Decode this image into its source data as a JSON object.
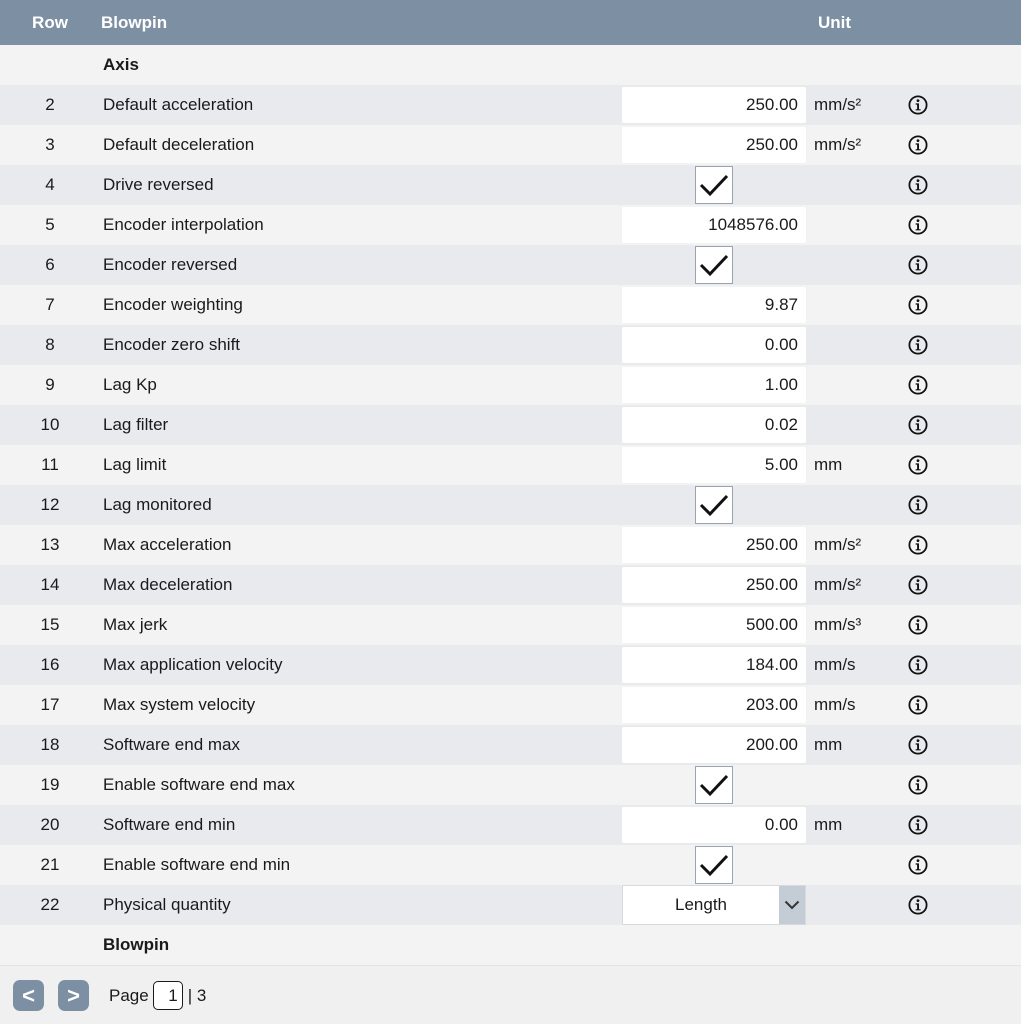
{
  "header": {
    "row_label": "Row",
    "name_label": "Blowpin",
    "unit_label": "Unit"
  },
  "sections": {
    "axis": "Axis",
    "blowpin": "Blowpin"
  },
  "rows": [
    {
      "row": "2",
      "name": "Default acceleration",
      "type": "value",
      "value": "250.00",
      "unit": "mm/s²"
    },
    {
      "row": "3",
      "name": "Default deceleration",
      "type": "value",
      "value": "250.00",
      "unit": "mm/s²"
    },
    {
      "row": "4",
      "name": "Drive reversed",
      "type": "check",
      "checked": true,
      "unit": ""
    },
    {
      "row": "5",
      "name": "Encoder interpolation",
      "type": "value",
      "value": "1048576.00",
      "unit": ""
    },
    {
      "row": "6",
      "name": "Encoder reversed",
      "type": "check",
      "checked": true,
      "unit": ""
    },
    {
      "row": "7",
      "name": "Encoder weighting",
      "type": "value",
      "value": "9.87",
      "unit": ""
    },
    {
      "row": "8",
      "name": "Encoder zero shift",
      "type": "value",
      "value": "0.00",
      "unit": ""
    },
    {
      "row": "9",
      "name": "Lag Kp",
      "type": "value",
      "value": "1.00",
      "unit": ""
    },
    {
      "row": "10",
      "name": "Lag filter",
      "type": "value",
      "value": "0.02",
      "unit": ""
    },
    {
      "row": "11",
      "name": "Lag limit",
      "type": "value",
      "value": "5.00",
      "unit": "mm"
    },
    {
      "row": "12",
      "name": "Lag monitored",
      "type": "check",
      "checked": true,
      "unit": ""
    },
    {
      "row": "13",
      "name": "Max acceleration",
      "type": "value",
      "value": "250.00",
      "unit": "mm/s²"
    },
    {
      "row": "14",
      "name": "Max deceleration",
      "type": "value",
      "value": "250.00",
      "unit": "mm/s²"
    },
    {
      "row": "15",
      "name": "Max jerk",
      "type": "value",
      "value": "500.00",
      "unit": "mm/s³"
    },
    {
      "row": "16",
      "name": "Max application velocity",
      "type": "value",
      "value": "184.00",
      "unit": "mm/s"
    },
    {
      "row": "17",
      "name": "Max system velocity",
      "type": "value",
      "value": "203.00",
      "unit": "mm/s"
    },
    {
      "row": "18",
      "name": "Software end max",
      "type": "value",
      "value": "200.00",
      "unit": "mm"
    },
    {
      "row": "19",
      "name": "Enable software end max",
      "type": "check",
      "checked": true,
      "unit": ""
    },
    {
      "row": "20",
      "name": "Software end min",
      "type": "value",
      "value": "0.00",
      "unit": "mm"
    },
    {
      "row": "21",
      "name": "Enable software end min",
      "type": "check",
      "checked": true,
      "unit": ""
    },
    {
      "row": "22",
      "name": "Physical quantity",
      "type": "select",
      "value": "Length",
      "unit": ""
    }
  ],
  "pagination": {
    "prev_label": "<",
    "next_label": ">",
    "page_label": "Page",
    "current_page": "1",
    "total_pages": "| 3"
  },
  "icons": {
    "info": "info-icon",
    "check": "checkmark-icon",
    "dropdown": "chevron-down-icon"
  },
  "colors": {
    "header_bg": "#7d8fa3",
    "row_alt_bg": "#e8eaed",
    "row_bg": "#f3f3f3",
    "select_arrow_bg": "#c4ccd5"
  }
}
